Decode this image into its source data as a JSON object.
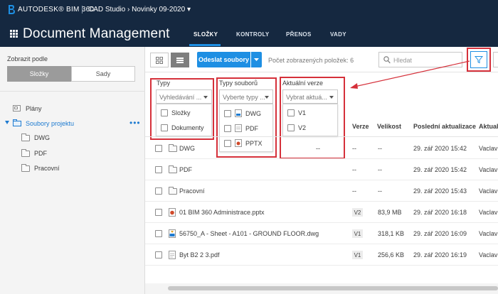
{
  "header": {
    "brand": "AUTODESK® BIM 360",
    "project": "CAD Studio › Novinky 09-2020 ▾",
    "app_title": "Document Management",
    "tabs": [
      {
        "label": "SLOŽKY",
        "active": true
      },
      {
        "label": "KONTROLY"
      },
      {
        "label": "PŘENOS"
      },
      {
        "label": "VADY"
      }
    ],
    "accent": "#1e8fe3",
    "bar_color": "#152840"
  },
  "sidebar": {
    "view_by_label": "Zobrazit podle",
    "segment_active": "Složky",
    "segment_inactive": "Sady",
    "tree": {
      "plans": "Plány",
      "project_files": "Soubory projektu",
      "children": [
        "DWG",
        "PDF",
        "Pracovní"
      ]
    }
  },
  "toolbar": {
    "upload_label": "Odeslat soubory",
    "count_text": "Počet zobrazených položek: 6",
    "search_placeholder": "Hledat"
  },
  "filters": {
    "types": {
      "label": "Typy",
      "placeholder": "Vyhledávání ...",
      "options": [
        "Složky",
        "Dokumenty"
      ]
    },
    "file_types": {
      "label": "Typy souborů",
      "placeholder": "Vyberte typy ...",
      "options": [
        "DWG",
        "PDF",
        "PPTX"
      ]
    },
    "current_version": {
      "label": "Aktuální verze",
      "placeholder": "Vybrat aktuá...",
      "options": [
        "V1",
        "V2"
      ]
    },
    "highlight_color": "#d5303a"
  },
  "table": {
    "columns": {
      "version": "Verze",
      "size": "Velikost",
      "updated": "Poslední aktualizace",
      "updated_by": "Aktualiz"
    },
    "rows": [
      {
        "name": "DWG",
        "mid": "--",
        "version": "--",
        "size": "--",
        "updated": "29. zář 2020 15:42",
        "by": "Vaclav S",
        "icon": "folder-icon"
      },
      {
        "name": "PDF",
        "mid": "",
        "version": "--",
        "size": "--",
        "updated": "29. zář 2020 15:42",
        "by": "Vaclav S",
        "icon": "folder-icon"
      },
      {
        "name": "Pracovní",
        "mid": "",
        "version": "--",
        "size": "--",
        "updated": "29. zář 2020 15:43",
        "by": "Vaclav S",
        "icon": "folder-icon"
      },
      {
        "name": "01 BIM 360 Administrace.pptx",
        "mid": "",
        "version": "V2",
        "size": "83,9 MB",
        "updated": "29. zář 2020 16:18",
        "by": "Vaclav S",
        "icon": "pptx-icon"
      },
      {
        "name": "56750_A - Sheet - A101 - GROUND FLOOR.dwg",
        "mid": "",
        "version": "V1",
        "size": "318,1 KB",
        "updated": "29. zář 2020 16:09",
        "by": "Vaclav S",
        "icon": "dwg-icon"
      },
      {
        "name": "Byt B2 2 3.pdf",
        "mid": "",
        "version": "V1",
        "size": "256,6 KB",
        "updated": "29. zář 2020 16:19",
        "by": "Vaclav S",
        "icon": "pdf-icon"
      }
    ]
  }
}
